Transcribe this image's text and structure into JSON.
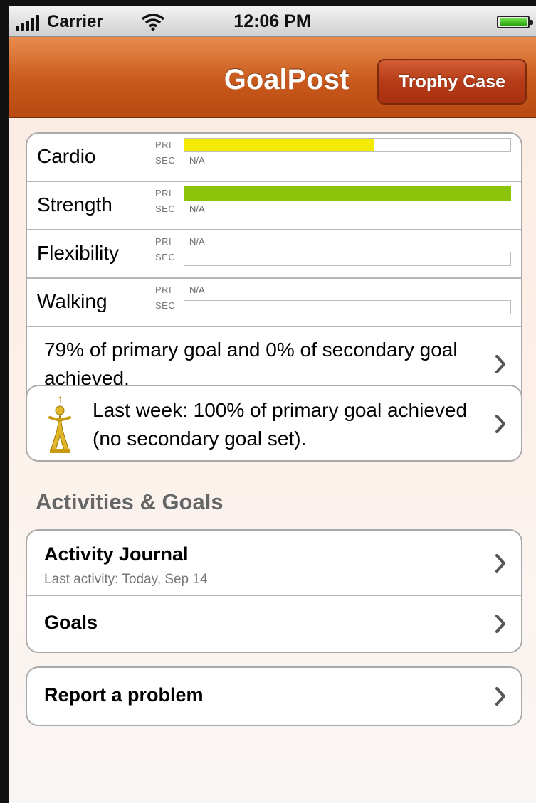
{
  "status_bar": {
    "carrier": "Carrier",
    "time": "12:06 PM",
    "icons": [
      "signal-icon",
      "wifi-icon",
      "battery-icon"
    ]
  },
  "nav_bar": {
    "title": "GoalPost",
    "right_button": "Trophy Case"
  },
  "progress": {
    "pri_label": "PRI",
    "sec_label": "SEC",
    "na_label": "N/A",
    "rows": [
      {
        "name": "Cardio",
        "pri_fraction": 0.58,
        "pri_color": "#f4ea06",
        "sec": "N/A"
      },
      {
        "name": "Strength",
        "pri_fraction": 1.0,
        "pri_color": "#8cc40a",
        "sec": "N/A"
      },
      {
        "name": "Flexibility",
        "pri": "N/A",
        "sec_fraction": 0.0
      },
      {
        "name": "Walking",
        "pri": "N/A",
        "sec_fraction": 0.0
      }
    ],
    "summary": "79% of primary goal and 0% of secondary goal achieved."
  },
  "last_week": {
    "icon": "trophy-icon",
    "text": "Last week: 100% of primary goal achieved (no secondary goal set)."
  },
  "activities": {
    "header": "Activities & Goals",
    "items": [
      {
        "title": "Activity Journal",
        "subtitle": "Last activity: Today, Sep 14"
      },
      {
        "title": "Goals"
      }
    ]
  },
  "support": {
    "report": "Report a problem"
  },
  "colors": {
    "nav_accent": "#c9591c",
    "button": "#b53c17",
    "cardio_bar": "#f4ea06",
    "strength_bar": "#8cc40a"
  }
}
